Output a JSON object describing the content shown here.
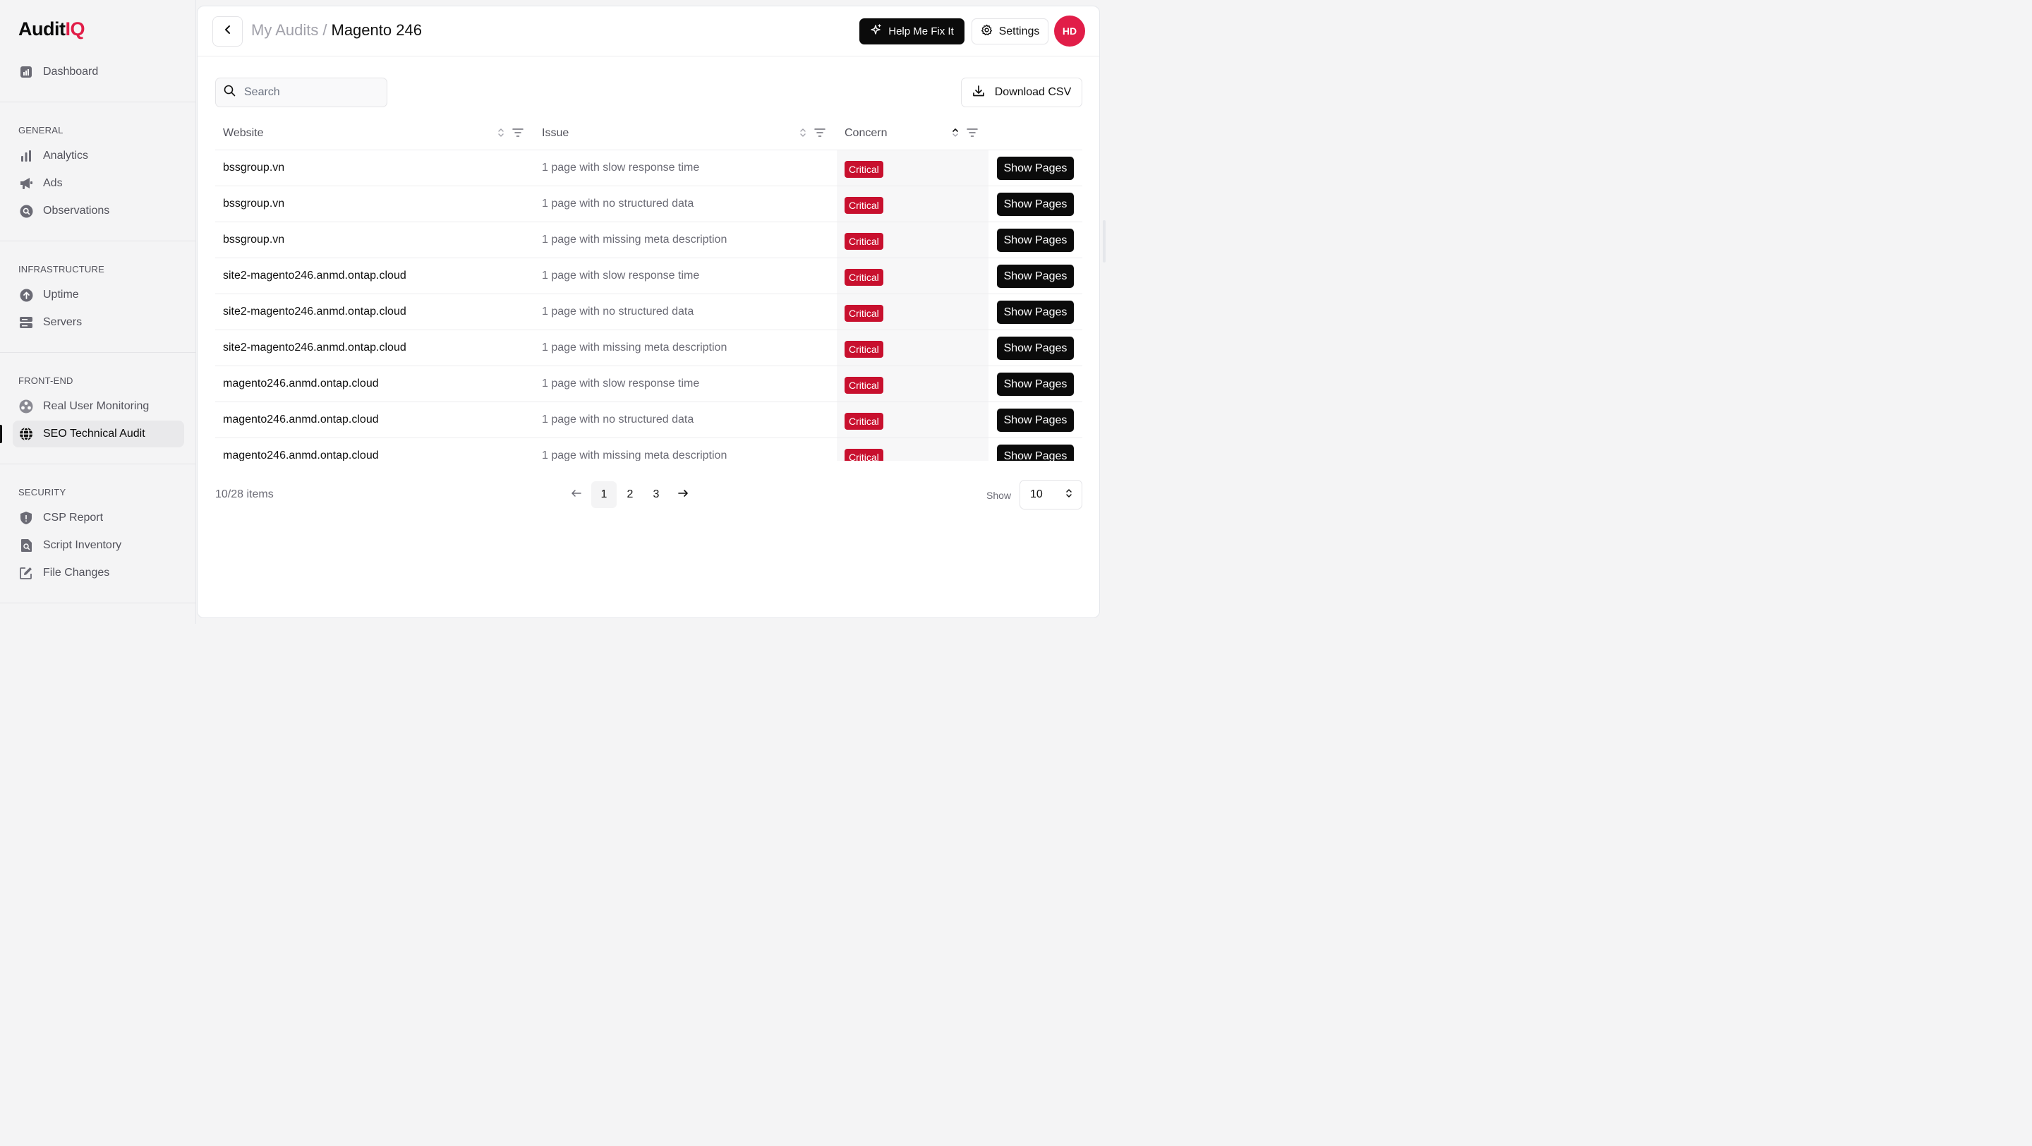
{
  "brand": {
    "name_part1": "Audit",
    "name_part2": "IQ",
    "accent": "#e11d48"
  },
  "sidebar": {
    "dashboard": {
      "label": "Dashboard",
      "icon": "dashboard-icon"
    },
    "sections": [
      {
        "title": "GENERAL",
        "items": [
          {
            "label": "Analytics",
            "icon": "bar-chart-icon"
          },
          {
            "label": "Ads",
            "icon": "megaphone-icon"
          },
          {
            "label": "Observations",
            "icon": "magnifier-circle-icon"
          }
        ]
      },
      {
        "title": "INFRASTRUCTURE",
        "items": [
          {
            "label": "Uptime",
            "icon": "arrow-up-circle-icon"
          },
          {
            "label": "Servers",
            "icon": "server-icon"
          }
        ]
      },
      {
        "title": "FRONT-END",
        "items": [
          {
            "label": "Real User Monitoring",
            "icon": "users-circle-icon"
          },
          {
            "label": "SEO Technical Audit",
            "icon": "globe-icon",
            "active": true
          }
        ]
      },
      {
        "title": "SECURITY",
        "items": [
          {
            "label": "CSP Report",
            "icon": "shield-icon"
          },
          {
            "label": "Script Inventory",
            "icon": "file-search-icon"
          },
          {
            "label": "File Changes",
            "icon": "edit-icon"
          }
        ]
      }
    ]
  },
  "header": {
    "breadcrumb_parent": "My Audits",
    "breadcrumb_sep": "/",
    "breadcrumb_current": "Magento 246",
    "help_label": "Help Me Fix It",
    "settings_label": "Settings",
    "avatar_initials": "HD"
  },
  "toolbar": {
    "search_placeholder": "Search",
    "search_value": "",
    "download_label": "Download CSV"
  },
  "table": {
    "columns": [
      "Website",
      "Issue",
      "Concern"
    ],
    "rows": [
      {
        "website": "bssgroup.vn",
        "issue": "1 page with slow response time",
        "concern": "Critical",
        "action": "Show Pages"
      },
      {
        "website": "bssgroup.vn",
        "issue": "1 page with no structured data",
        "concern": "Critical",
        "action": "Show Pages"
      },
      {
        "website": "bssgroup.vn",
        "issue": "1 page with missing meta description",
        "concern": "Critical",
        "action": "Show Pages"
      },
      {
        "website": "site2-magento246.anmd.ontap.cloud",
        "issue": "1 page with slow response time",
        "concern": "Critical",
        "action": "Show Pages"
      },
      {
        "website": "site2-magento246.anmd.ontap.cloud",
        "issue": "1 page with no structured data",
        "concern": "Critical",
        "action": "Show Pages"
      },
      {
        "website": "site2-magento246.anmd.ontap.cloud",
        "issue": "1 page with missing meta description",
        "concern": "Critical",
        "action": "Show Pages"
      },
      {
        "website": "magento246.anmd.ontap.cloud",
        "issue": "1 page with slow response time",
        "concern": "Critical",
        "action": "Show Pages"
      },
      {
        "website": "magento246.anmd.ontap.cloud",
        "issue": "1 page with no structured data",
        "concern": "Critical",
        "action": "Show Pages"
      },
      {
        "website": "magento246.anmd.ontap.cloud",
        "issue": "1 page with missing meta description",
        "concern": "Critical",
        "action": "Show Pages"
      }
    ],
    "critical_color": "#c8102e"
  },
  "pagination": {
    "items_label": "10/28 items",
    "pages": [
      "1",
      "2",
      "3"
    ],
    "current_page": "1",
    "show_label": "Show",
    "page_size": "10"
  }
}
